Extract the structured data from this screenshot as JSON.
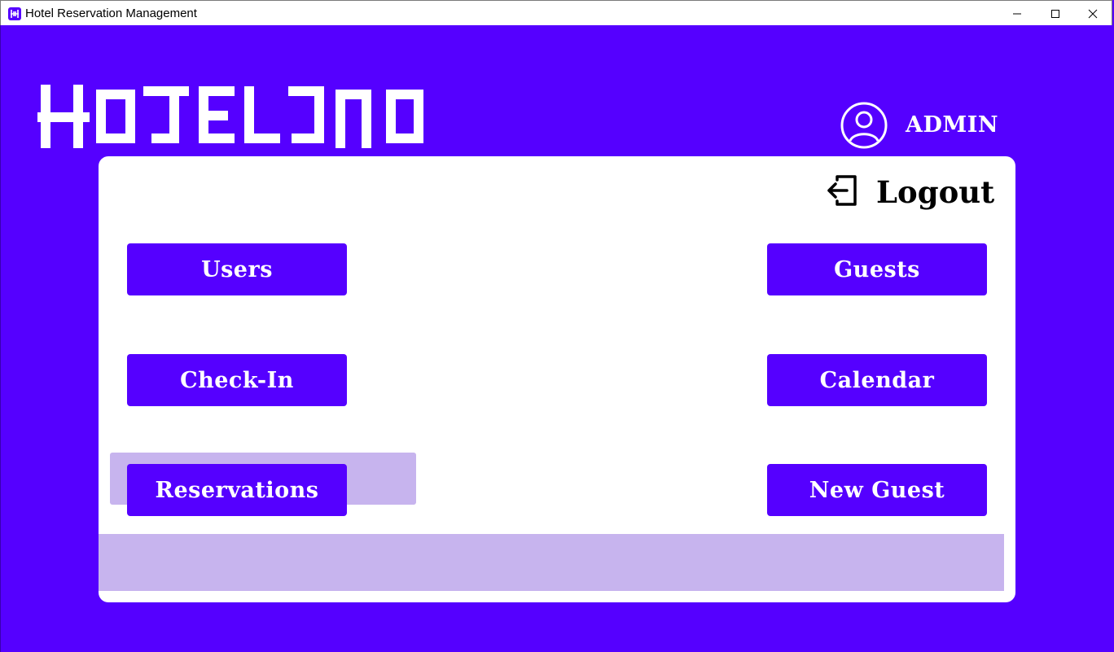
{
  "window": {
    "title": "Hotel Reservation Management",
    "icon": "hotel-app-icon",
    "controls": [
      "minimize-icon",
      "maximize-icon",
      "close-icon"
    ]
  },
  "header": {
    "logo_text": "HOTELINO",
    "user_icon": "user-circle-icon",
    "user_label": "ADMIN"
  },
  "panel": {
    "logout_icon": "logout-icon",
    "logout_label": "Logout",
    "buttons": {
      "users": "Users",
      "guests": "Guests",
      "check_in": "Check-In",
      "calendar": "Calendar",
      "reservations": "Reservations",
      "new_guest": "New Guest"
    }
  },
  "colors": {
    "accent": "#5500ff",
    "highlight": "#c7b4ee",
    "panel": "#ffffff"
  }
}
